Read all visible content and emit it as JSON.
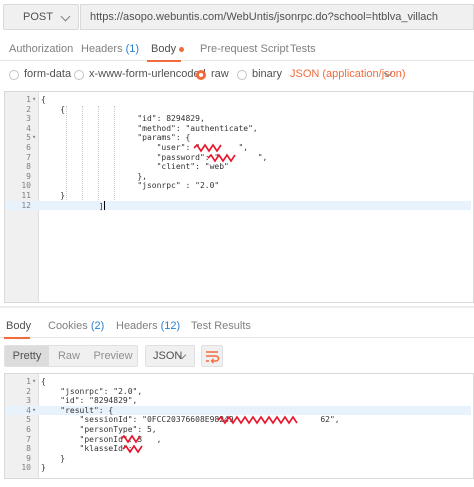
{
  "request": {
    "method": "POST",
    "url": "https://asopo.webuntis.com/WebUntis/jsonrpc.do?school=htblva_villach",
    "tabs": [
      {
        "label": "Authorization",
        "count": ""
      },
      {
        "label": "Headers",
        "count": "(1)"
      },
      {
        "label": "Body",
        "count": ""
      },
      {
        "label": "Pre-request Script",
        "count": ""
      },
      {
        "label": "Tests",
        "count": ""
      }
    ],
    "active_tab": "Body",
    "body_modes": [
      "form-data",
      "x-www-form-urlencoded",
      "raw",
      "binary"
    ],
    "selected_mode": "raw",
    "content_type": "JSON (application/json)",
    "body_lines": [
      {
        "n": "1",
        "fold": "▾",
        "code": "{"
      },
      {
        "n": "2",
        "fold": "",
        "code": "    {"
      },
      {
        "n": "3",
        "fold": "",
        "code": "                    \"id\": 8294829,"
      },
      {
        "n": "4",
        "fold": "",
        "code": "                    \"method\": \"authenticate\","
      },
      {
        "n": "5",
        "fold": "▾",
        "code": "                    \"params\": {"
      },
      {
        "n": "6",
        "fold": "",
        "code": "                        \"user\": \"        \","
      },
      {
        "n": "7",
        "fold": "",
        "code": "                        \"password\": \"        \","
      },
      {
        "n": "8",
        "fold": "",
        "code": "                        \"client\": \"web\""
      },
      {
        "n": "9",
        "fold": "",
        "code": "                    },"
      },
      {
        "n": "10",
        "fold": "",
        "code": "                    \"jsonrpc\" : \"2.0\""
      },
      {
        "n": "11",
        "fold": "",
        "code": "    }"
      },
      {
        "n": "12",
        "fold": "",
        "code": "            ]"
      }
    ]
  },
  "response": {
    "tabs": [
      {
        "label": "Body",
        "count": ""
      },
      {
        "label": "Cookies",
        "count": "(2)"
      },
      {
        "label": "Headers",
        "count": "(12)"
      },
      {
        "label": "Test Results",
        "count": ""
      }
    ],
    "view_modes": [
      "Pretty",
      "Raw",
      "Preview"
    ],
    "active_view": "Pretty",
    "format": "JSON",
    "body_lines": [
      {
        "n": "1",
        "fold": "▾",
        "code": "{"
      },
      {
        "n": "2",
        "fold": "",
        "code": "    \"jsonrpc\": \"2.0\","
      },
      {
        "n": "3",
        "fold": "",
        "code": "    \"id\": \"8294829\","
      },
      {
        "n": "4",
        "fold": "▾",
        "code": "    \"result\": {"
      },
      {
        "n": "5",
        "fold": "",
        "code": "        \"sessionId\": \"0FCC20376608E98249                  62\","
      },
      {
        "n": "6",
        "fold": "",
        "code": "        \"personType\": 5,"
      },
      {
        "n": "7",
        "fold": "",
        "code": "        \"personId\": 3   ,"
      },
      {
        "n": "8",
        "fold": "",
        "code": "        \"klasseId\":     "
      },
      {
        "n": "9",
        "fold": "",
        "code": "    }"
      },
      {
        "n": "10",
        "fold": "",
        "code": "}"
      }
    ]
  },
  "colors": {
    "accent": "#f26b3a",
    "link": "#2a80d0",
    "redaction": "#e8142a"
  },
  "icons": {
    "wrap": "wrap-lines-icon",
    "dropdown": "chevron-down-icon"
  }
}
